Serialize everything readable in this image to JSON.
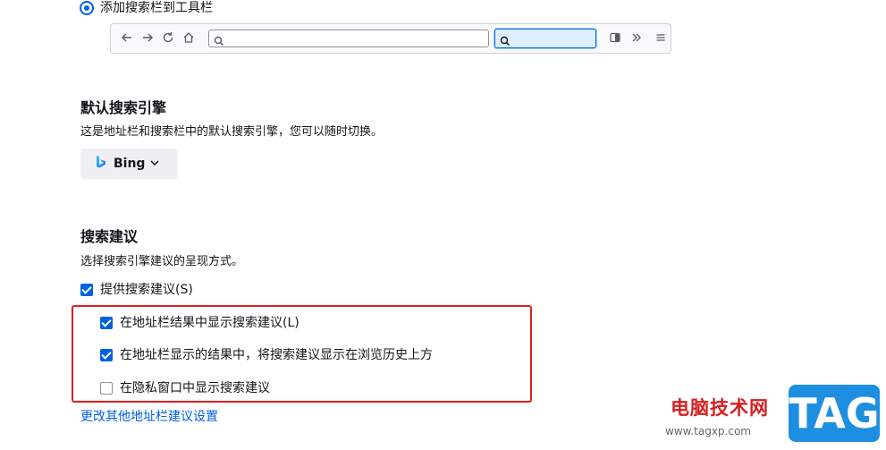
{
  "toolbar_option": {
    "label": "添加搜索栏到工具栏",
    "selected": true
  },
  "toolbar_preview": {
    "icons": [
      "back-arrow-icon",
      "forward-arrow-icon",
      "reload-icon",
      "home-icon",
      "search-icon",
      "sidebar-icon",
      "overflow-chevrons-icon",
      "hamburger-menu-icon"
    ]
  },
  "default_engine": {
    "title": "默认搜索引擎",
    "description": "这是地址栏和搜索栏中的默认搜索引擎，您可以随时切换。",
    "selected_engine": "Bing",
    "engine_icon": "bing-logo-icon"
  },
  "suggestions": {
    "title": "搜索建议",
    "description": "选择搜索引擎建议的呈现方式。",
    "provide_label": "提供搜索建议(S)",
    "provide_checked": true,
    "options": [
      {
        "label": "在地址栏结果中显示搜索建议(L)",
        "checked": true
      },
      {
        "label": "在地址栏显示的结果中，将搜索建议显示在浏览历史上方",
        "checked": true
      },
      {
        "label": "在隐私窗口中显示搜索建议",
        "checked": false
      }
    ],
    "link": "更改其他地址栏建议设置"
  },
  "watermark": {
    "text": "电脑技术网",
    "url": "www.tagxp.com",
    "logo": "TAG"
  },
  "colors": {
    "accent": "#0061e0",
    "highlight_border": "#e02020"
  }
}
